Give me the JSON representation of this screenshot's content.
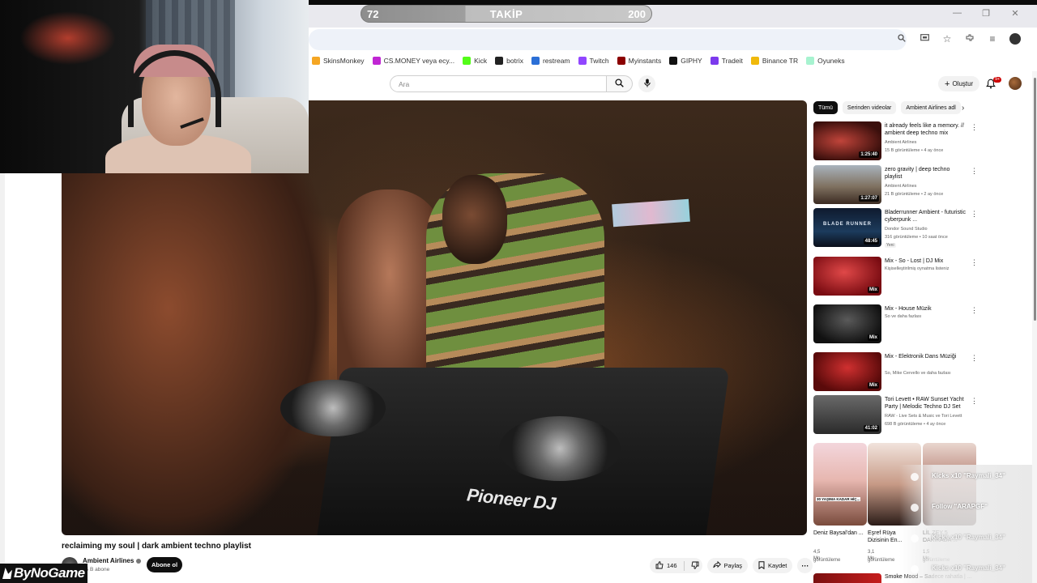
{
  "follow_goal": {
    "current": "72",
    "label": "TAKİP",
    "target": "200",
    "progress": 0.36
  },
  "bookmarks": [
    {
      "label": "SkinsMonkey",
      "color": "#f5a623"
    },
    {
      "label": "CS.MONEY veya ecy...",
      "color": "#c026d3"
    },
    {
      "label": "Kick",
      "color": "#53fc18"
    },
    {
      "label": "botrix",
      "color": "#222222"
    },
    {
      "label": "restream",
      "color": "#2b6fd6"
    },
    {
      "label": "Twitch",
      "color": "#9146ff"
    },
    {
      "label": "Myinstants",
      "color": "#8b0000"
    },
    {
      "label": "GIPHY",
      "color": "#111111"
    },
    {
      "label": "Tradeit",
      "color": "#7c3aed"
    },
    {
      "label": "Binance TR",
      "color": "#f0b90b"
    },
    {
      "label": "Oyuneks",
      "color": "#a7f3d0"
    }
  ],
  "search": {
    "placeholder": "Ara"
  },
  "masthead": {
    "create_label": "Oluştur",
    "notifications": "9+"
  },
  "video": {
    "title": "reclaiming my soul | dark ambient techno playlist",
    "channel": "Ambient Airlines",
    "subscribers": "15 B abone",
    "subscribe_label": "Abone ol",
    "likes": "146",
    "share_label": "Paylaş",
    "save_label": "Kaydet",
    "brand_text": "Pioneer DJ"
  },
  "chips": {
    "items": [
      "Tümü",
      "Serinden videolar",
      "Ambient Airlines adl"
    ],
    "active_index": 0
  },
  "sidebar": {
    "items": [
      {
        "title": "it already feels like a memory. // ambient deep techno mix",
        "channel": "Ambient Airlines",
        "meta": "15 B görüntüleme • 4 ay önce",
        "badge": "1:25:40"
      },
      {
        "title": "zero gravity | deep techno playlist",
        "channel": "Ambient Airlines",
        "meta": "21 B görüntüleme • 2 ay önce",
        "badge": "1:27:07"
      },
      {
        "title": "Bladerrunner Ambient - futuristic cyberpunk ...",
        "channel": "Dondor Sound Studio",
        "meta": "316 görüntüleme • 10 saat önce",
        "badge": "48:45",
        "new_label": "Yeni",
        "thumb_text": "BLADE RUNNER"
      },
      {
        "title": "Mix - So - Lost | DJ Mix",
        "channel": "Kişiselleştirilmiş oynatma listeniz",
        "meta": "",
        "badge": "Mix"
      },
      {
        "title": "Mix - House Müzik",
        "channel": "So ve daha fazlası",
        "meta": "",
        "badge": "Mix"
      },
      {
        "title": "Mix - Elektronik Dans Müziği",
        "channel": "So, Mike Cervello ve daha fazlası",
        "meta": "",
        "badge": "Mix"
      },
      {
        "title": "Tori Levett • RAW Sunset Yacht Party | Melodic Techno DJ Set",
        "channel": "RAW - Live Sets & Music ve Tori Levett",
        "meta": "698 B görüntüleme • 4 ay önce",
        "badge": "41:02"
      }
    ],
    "last_title": "Smoke Mood – Sadece rahatla | ..."
  },
  "shorts": [
    {
      "title": "Deniz Baysal'dan ...",
      "views": "4,5 Mn",
      "views_label": "görüntüleme",
      "overlay": "30 YAŞIMA KADAR HİÇ..."
    },
    {
      "title": "Eşref Rüya Dizisinin En...",
      "views": "3,1 Mn",
      "views_label": "görüntüleme"
    },
    {
      "title": "LİL ZEY 5 DAKİKADA ...",
      "views": "1,5 Mn",
      "views_label": "görüntüleme"
    }
  ],
  "alerts": [
    {
      "text": "Kicks x10 \"Raymali_34\""
    },
    {
      "text": "Follow \"ARAPGF\""
    },
    {
      "text": "Kicks x10 \"Raymali_34\""
    },
    {
      "text": "Kicks x10 \"Raymali_34\""
    }
  ],
  "watermark": {
    "text": "ByNoGame"
  },
  "icons": {
    "zoom": "zoom-icon",
    "cast": "cast-icon",
    "bookmark": "star-icon",
    "extensions": "puzzle-icon",
    "search": "search-icon",
    "mic": "mic-icon",
    "bell": "bell-icon",
    "more": "more-vert-icon"
  }
}
